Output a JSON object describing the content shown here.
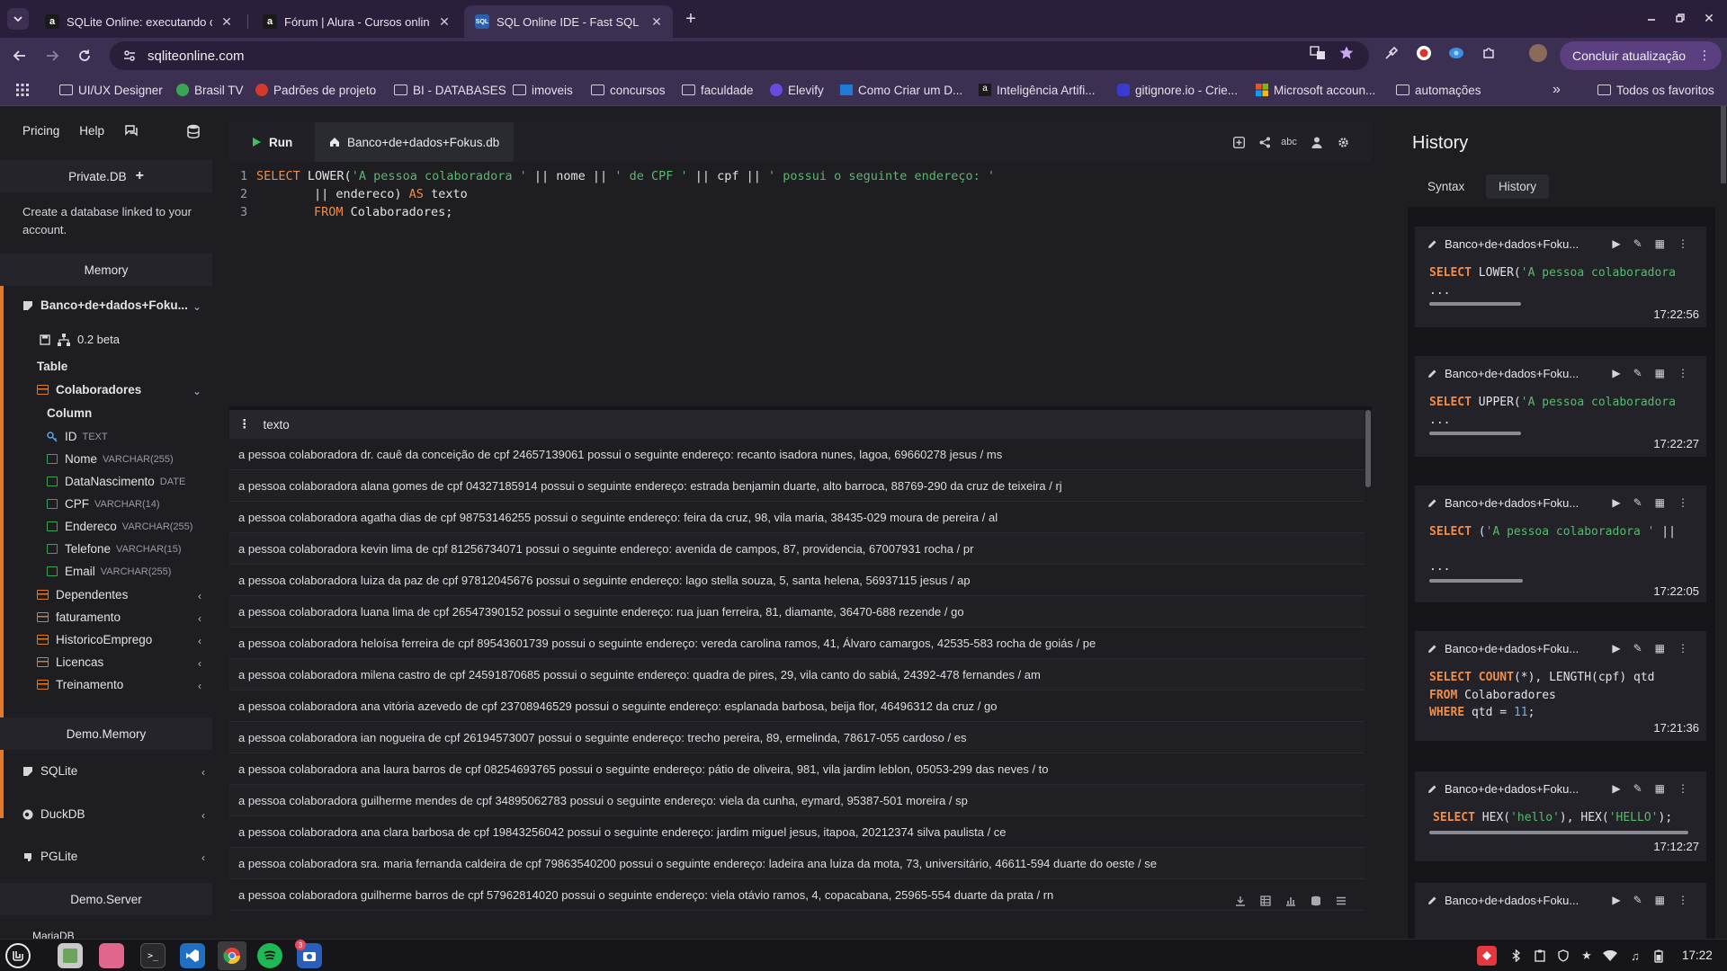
{
  "browser": {
    "tabs": [
      {
        "title": "SQLite Online: executando c",
        "favicon": "alura-icon"
      },
      {
        "title": "Fórum | Alura - Cursos online",
        "favicon": "alura-icon"
      },
      {
        "title": "SQL Online IDE - Fast SQL Ed",
        "favicon": "sql-icon",
        "favicon_text": "SQL",
        "active": true
      }
    ],
    "url": "sqliteonline.com",
    "update_button": "Concluir atualização",
    "bookmarks": [
      "UI/UX Designer",
      "Brasil TV",
      "Padrões de projeto",
      "BI - DATABASES",
      "imoveis",
      "concursos",
      "faculdade",
      "Elevify",
      "Como Criar um D...",
      "Inteligência Artifi...",
      "gitignore.io - Crie...",
      "Microsoft accoun...",
      "automações"
    ],
    "all_bookmarks": "Todos os favoritos"
  },
  "sidebar": {
    "links": [
      "Pricing",
      "Help"
    ],
    "private_db": "Private.DB",
    "private_note": "Create a database linked to your account.",
    "memory": "Memory",
    "db_name": "Banco+de+dados+Foku...",
    "db_version": "0.2 beta",
    "table_label": "Table",
    "main_table": "Colaboradores",
    "column_label": "Column",
    "columns": [
      {
        "name": "ID",
        "type": "TEXT"
      },
      {
        "name": "Nome",
        "type": "VARCHAR(255)"
      },
      {
        "name": "DataNascimento",
        "type": "DATE"
      },
      {
        "name": "CPF",
        "type": "VARCHAR(14)"
      },
      {
        "name": "Endereco",
        "type": "VARCHAR(255)"
      },
      {
        "name": "Telefone",
        "type": "VARCHAR(15)"
      },
      {
        "name": "Email",
        "type": "VARCHAR(255)"
      }
    ],
    "tables": [
      "Dependentes",
      "faturamento",
      "HistoricoEmprego",
      "Licencas",
      "Treinamento"
    ],
    "demo_memory": "Demo.Memory",
    "engines": [
      "SQLite",
      "DuckDB",
      "PGLite"
    ],
    "demo_server": "Demo.Server",
    "cut_item": "MariaDB"
  },
  "editor": {
    "run_label": "Run",
    "db_tab": "Banco+de+dados+Fokus.db",
    "line_numbers": [
      "1",
      "2",
      "3"
    ],
    "line1": {
      "kw1": "SELECT",
      "fn": " LOWER(",
      "s1": "'A pessoa colaboradora '",
      "t1": " || nome || ",
      "s2": "' de CPF '",
      "t2": " || cpf || ",
      "s3": "' possui o seguinte endereço: '"
    },
    "line2": {
      "t1": "|| endereco) ",
      "kw": "AS",
      "t2": " texto"
    },
    "line3": {
      "kw": "FROM",
      "t": " Colaboradores;"
    }
  },
  "results": {
    "column": "texto",
    "rows": [
      "a pessoa colaboradora dr. cauê da conceição de cpf 24657139061 possui o seguinte endereço: recanto isadora nunes, lagoa, 69660278 jesus / ms",
      "a pessoa colaboradora alana gomes de cpf 04327185914 possui o seguinte endereço: estrada benjamin duarte, alto barroca, 88769-290 da cruz de teixeira / rj",
      "a pessoa colaboradora agatha dias de cpf 98753146255 possui o seguinte endereço: feira da cruz, 98, vila maria, 38435-029 moura de pereira / al",
      "a pessoa colaboradora kevin lima de cpf 81256734071 possui o seguinte endereço: avenida de campos, 87, providencia, 67007931 rocha / pr",
      "a pessoa colaboradora luiza da paz de cpf 97812045676 possui o seguinte endereço: lago stella souza, 5, santa helena, 56937115 jesus / ap",
      "a pessoa colaboradora luana lima de cpf 26547390152 possui o seguinte endereço: rua juan ferreira, 81, diamante, 36470-688 rezende / go",
      "a pessoa colaboradora heloísa ferreira de cpf 89543601739 possui o seguinte endereço: vereda carolina ramos, 41, Álvaro camargos, 42535-583 rocha de goiás / pe",
      "a pessoa colaboradora milena castro de cpf 24591870685 possui o seguinte endereço: quadra de pires, 29, vila canto do sabiá, 24392-478 fernandes / am",
      "a pessoa colaboradora ana vitória azevedo de cpf 23708946529 possui o seguinte endereço: esplanada barbosa, beija flor, 46496312 da cruz / go",
      "a pessoa colaboradora ian nogueira de cpf 26194573007 possui o seguinte endereço: trecho pereira, 89, ermelinda, 78617-055 cardoso / es",
      "a pessoa colaboradora ana laura barros de cpf 08254693765 possui o seguinte endereço: pátio de oliveira, 981, vila jardim leblon, 05053-299 das neves / to",
      "a pessoa colaboradora guilherme mendes de cpf 34895062783 possui o seguinte endereço: viela da cunha, eymard, 95387-501 moreira / sp",
      "a pessoa colaboradora ana clara barbosa de cpf 19843256042 possui o seguinte endereço: jardim miguel jesus, itapoa, 20212374 silva paulista / ce",
      "a pessoa colaboradora sra. maria fernanda caldeira de cpf 79863540200 possui o seguinte endereço: ladeira ana luiza da mota, 73, universitário, 46611-594 duarte do oeste / se",
      "a pessoa colaboradora guilherme barros de cpf 57962814020 possui o seguinte endereço: viela otávio ramos, 4, copacabana, 25965-554 duarte da prata / rn"
    ]
  },
  "history": {
    "title": "History",
    "tabs": [
      "Syntax",
      "History"
    ],
    "items": [
      {
        "db": "Banco+de+dados+Foku...",
        "kw": "SELECT",
        "code": " LOWER(",
        "str": "'A pessoa colaboradora",
        "more": "...",
        "time": "17:22:56",
        "progress": 0.42
      },
      {
        "db": "Banco+de+dados+Foku...",
        "kw": "SELECT",
        "code": " UPPER(",
        "str": "'A pessoa colaboradora",
        "more": "...",
        "time": "17:22:27",
        "progress": 0.42
      },
      {
        "db": "Banco+de+dados+Foku...",
        "kw": "SELECT",
        "code": " (",
        "str": "'A pessoa colaboradora '",
        "tail": " ||",
        "more": "...",
        "time": "17:22:05",
        "progress": 0.42
      },
      {
        "db": "Banco+de+dados+Foku...",
        "l1kw": "SELECT",
        "l1kw2": "COUNT",
        "l1": "(*), LENGTH(cpf) qtd",
        "l2kw": "FROM",
        "l2": " Colaboradores",
        "l3kw": "WHERE",
        "l3": " qtd = ",
        "l3num": "11",
        "l3end": ";",
        "time": "17:21:36"
      },
      {
        "db": "Banco+de+dados+Foku...",
        "kw": "SELECT",
        "c1": " HEX(",
        "s1": "'hello'",
        "c2": "), HEX(",
        "s2": "'HELLO'",
        "c3": ");",
        "time": "17:12:27",
        "progress": 0.98
      },
      {
        "db": "Banco+de+dados+Foku..."
      }
    ]
  },
  "taskbar": {
    "clock": "17:22",
    "badge": "3"
  },
  "colors": {
    "accent": "#e07a2a",
    "keyword": "#f08d49",
    "string": "#5ab96e",
    "number": "#6fb1e8"
  }
}
